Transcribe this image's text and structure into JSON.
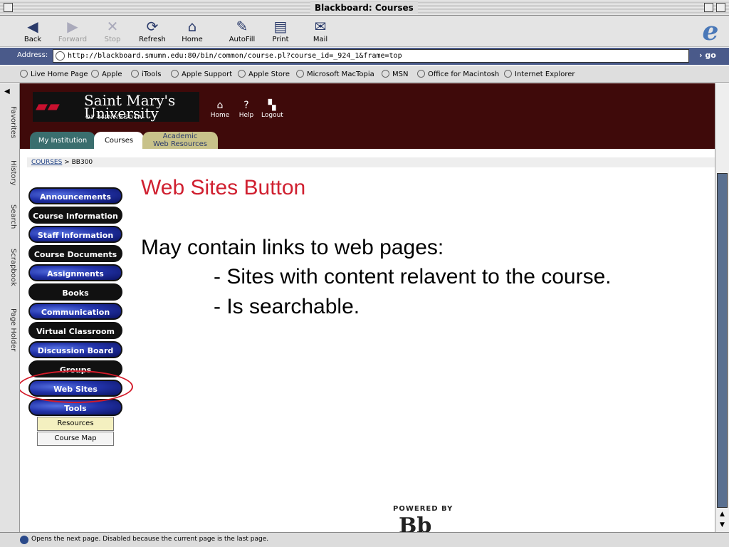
{
  "window": {
    "title": "Blackboard: Courses"
  },
  "toolbar": {
    "buttons": [
      {
        "label": "Back",
        "icon": "back-arrow-icon",
        "glyph": "◀",
        "enabled": true
      },
      {
        "label": "Forward",
        "icon": "forward-arrow-icon",
        "glyph": "▶",
        "enabled": false
      },
      {
        "label": "Stop",
        "icon": "stop-x-icon",
        "glyph": "✕",
        "enabled": false
      },
      {
        "label": "Refresh",
        "icon": "refresh-icon",
        "glyph": "⟳",
        "enabled": true
      },
      {
        "label": "Home",
        "icon": "house-icon",
        "glyph": "⌂",
        "enabled": true
      },
      {
        "label": "AutoFill",
        "icon": "autofill-icon",
        "glyph": "✎",
        "enabled": true
      },
      {
        "label": "Print",
        "icon": "printer-icon",
        "glyph": "▤",
        "enabled": true
      },
      {
        "label": "Mail",
        "icon": "mail-icon",
        "glyph": "✉",
        "enabled": true
      }
    ]
  },
  "address": {
    "label": "Address:",
    "url": "http://blackboard.smumn.edu:80/bin/common/course.pl?course_id=_924_1&frame=top",
    "go_label": "go"
  },
  "favorites": [
    "Live Home Page",
    "Apple",
    "iTools",
    "Apple Support",
    "Apple Store",
    "Microsoft MacTopia",
    "MSN",
    "Office for Macintosh",
    "Internet Explorer"
  ],
  "explorer_tabs": [
    "Favorites",
    "History",
    "Search",
    "Scrapbook",
    "Page Holder"
  ],
  "header": {
    "logo_line1": "Saint Mary's",
    "logo_line2": "University",
    "logo_line3": "OF MINNESOTA",
    "nav": [
      "Home",
      "Help",
      "Logout"
    ],
    "tabs": {
      "my_institution": "My Institution",
      "courses": "Courses",
      "academic_line1": "Academic",
      "academic_line2": "Web Resources"
    }
  },
  "breadcrumb": {
    "link": "COURSES",
    "sep": ">",
    "current": "BB300"
  },
  "course_menu": [
    "Announcements",
    "Course Information",
    "Staff Information",
    "Course Documents",
    "Assignments",
    "Books",
    "Communication",
    "Virtual Classroom",
    "Discussion Board",
    "Groups",
    "Web Sites",
    "Tools"
  ],
  "sub_menu": [
    "Resources",
    "Course Map"
  ],
  "content": {
    "title": "Web Sites Button",
    "line1": "May contain links to web pages:",
    "line2": "- Sites with content relavent to the course.",
    "line3": "- Is searchable."
  },
  "footer": {
    "powered_by": "POWERED BY",
    "logo": "Bb"
  },
  "status": {
    "text": "Opens the next page. Disabled because the current page is the last page."
  },
  "colors": {
    "header_bg": "#3f0a0a",
    "title_red": "#d02030",
    "highlight_red": "#d31b2a"
  }
}
